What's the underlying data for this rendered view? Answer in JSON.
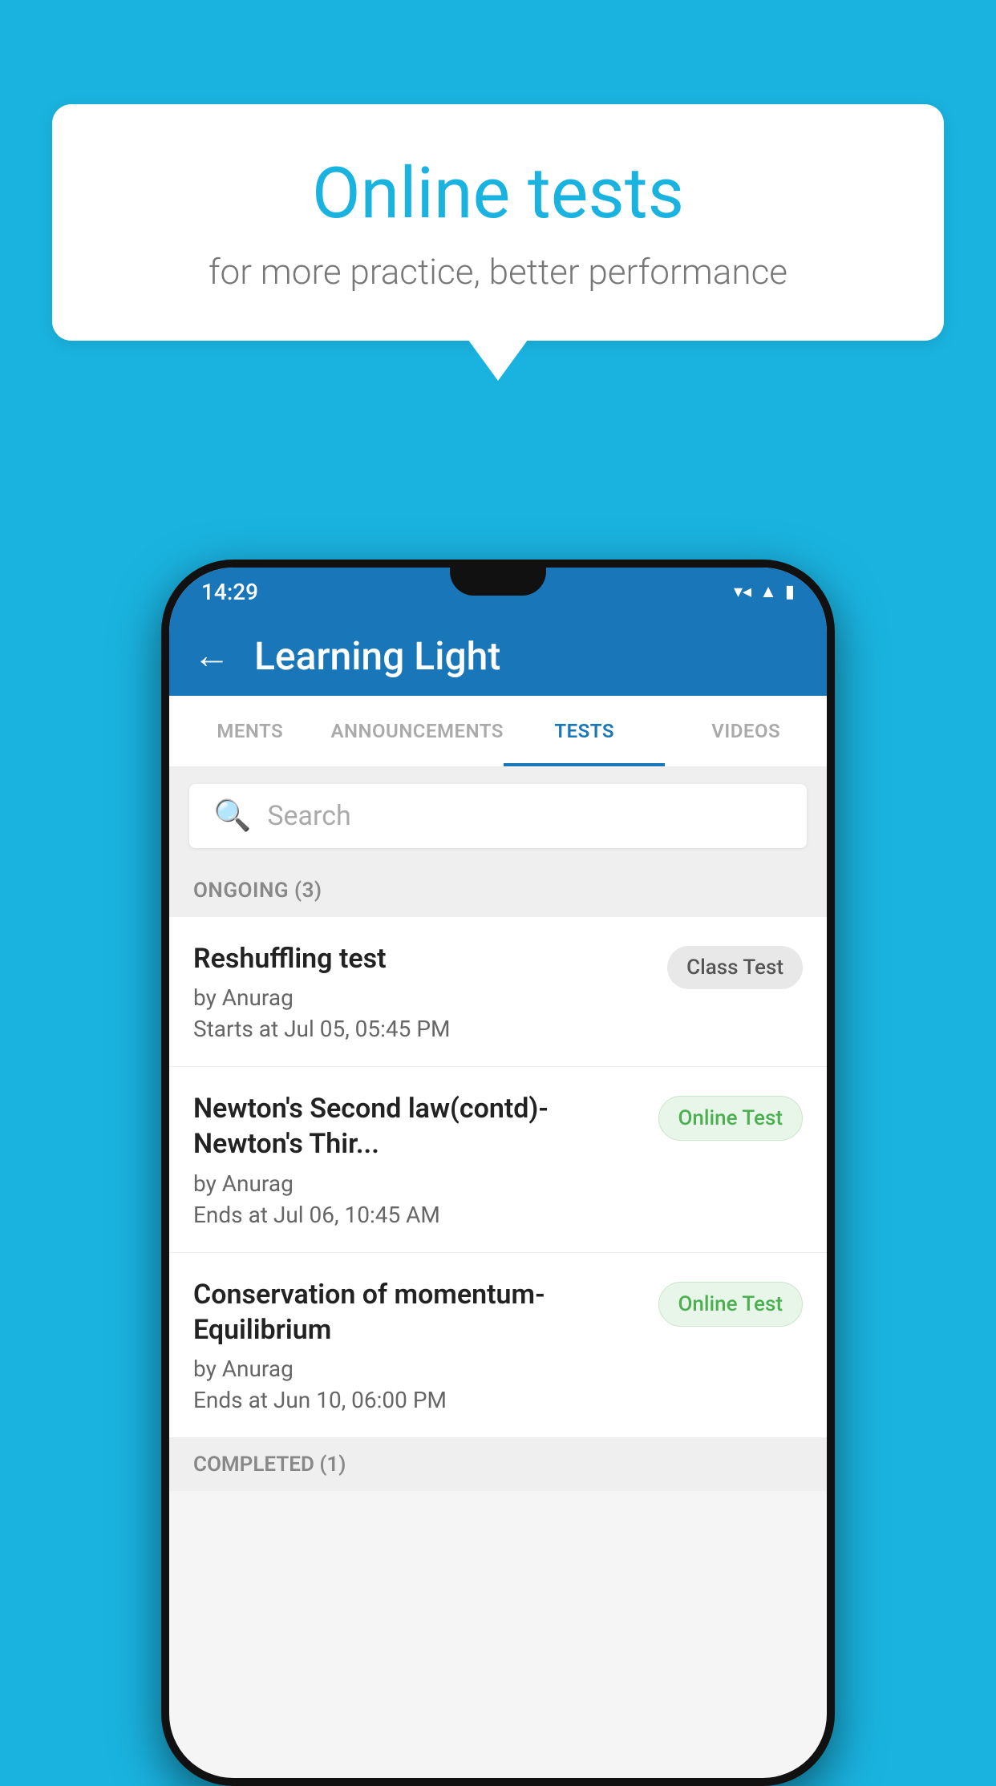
{
  "background_color": "#1ab3e0",
  "speech_bubble": {
    "title": "Online tests",
    "subtitle": "for more practice, better performance"
  },
  "phone": {
    "status_bar": {
      "time": "14:29",
      "icons": [
        "▼",
        "▲",
        "▮"
      ]
    },
    "app_bar": {
      "back_label": "←",
      "title": "Learning Light"
    },
    "tabs": [
      {
        "label": "MENTS",
        "active": false
      },
      {
        "label": "ANNOUNCEMENTS",
        "active": false
      },
      {
        "label": "TESTS",
        "active": true
      },
      {
        "label": "VIDEOS",
        "active": false
      }
    ],
    "search": {
      "placeholder": "Search",
      "icon": "🔍"
    },
    "ongoing_section": {
      "label": "ONGOING (3)",
      "tests": [
        {
          "title": "Reshuffling test",
          "author": "by Anurag",
          "time_label": "Starts at",
          "time": "Jul 05, 05:45 PM",
          "badge": "Class Test",
          "badge_type": "class"
        },
        {
          "title": "Newton's Second law(contd)-Newton's Thir...",
          "author": "by Anurag",
          "time_label": "Ends at",
          "time": "Jul 06, 10:45 AM",
          "badge": "Online Test",
          "badge_type": "online"
        },
        {
          "title": "Conservation of momentum-Equilibrium",
          "author": "by Anurag",
          "time_label": "Ends at",
          "time": "Jun 10, 06:00 PM",
          "badge": "Online Test",
          "badge_type": "online"
        }
      ]
    },
    "completed_section": {
      "label": "COMPLETED (1)"
    }
  }
}
